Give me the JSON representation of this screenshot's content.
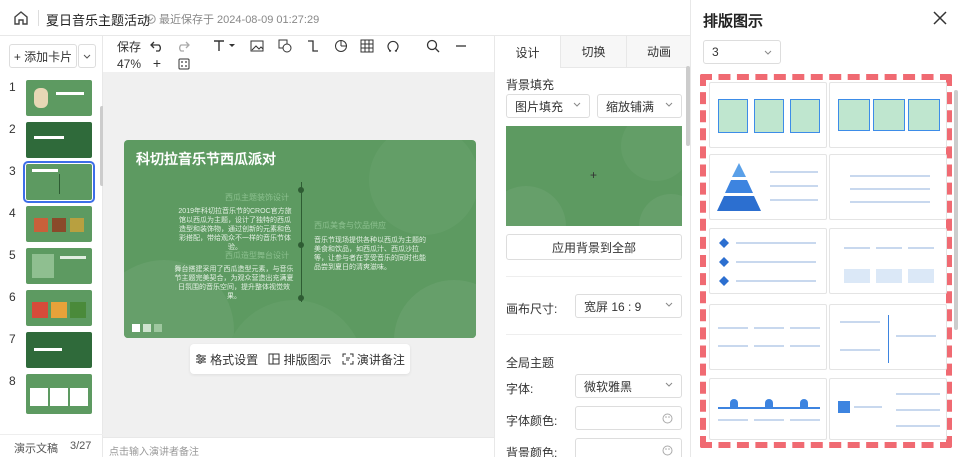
{
  "header": {
    "title": "夏日音乐主题活动",
    "save_status": "最近保存于 2024-08-09 01:27:29"
  },
  "sidebar": {
    "add_card_label": "+ 添加卡片",
    "slides": [
      "1",
      "2",
      "3",
      "4",
      "5",
      "6",
      "7",
      "8"
    ],
    "selected_index": 3,
    "footer_label": "演示文稿",
    "page_indicator": "3/27"
  },
  "toolbar": {
    "save_label": "保存",
    "zoom": "47%",
    "zoom_in": "+"
  },
  "slide": {
    "title": "科切拉音乐节西瓜派对",
    "heading_left_1": "西瓜主题装饰设计",
    "text_left_1": "2019年科切拉音乐节的CROC官方旅馆以西瓜为主题，设计了独特的西瓜造型和装饰物，通过创新的元素和色彩搭配，带给观众不一样的音乐节体验。",
    "heading_right": "西瓜美食与饮品供应",
    "text_right": "音乐节现场提供各种以西瓜为主题的美食和饮品，如西瓜汁、西瓜沙拉等，让参与者在享受音乐的同时也能品尝到夏日的清爽滋味。",
    "heading_left_2": "西瓜造型舞台设计",
    "text_left_2": "舞台搭建采用了西瓜造型元素，与音乐节主题完美契合，为观众营造出充满夏日氛围的音乐空间，提升整体视觉效果。"
  },
  "action_bar": {
    "format_label": "格式设置",
    "layout_label": "排版图示",
    "notes_label": "演讲备注"
  },
  "notes_placeholder": "点击输入演讲者备注",
  "properties": {
    "tabs": [
      "设计",
      "切换",
      "动画"
    ],
    "bg_fill_label": "背景填充",
    "fill_type": "图片填充",
    "fill_mode": "缩放铺满",
    "preview_plus": "+",
    "apply_all_label": "应用背景到全部",
    "canvas_size_label": "画布尺寸:",
    "canvas_size_value": "宽屏 16 : 9",
    "theme_label": "全局主题",
    "font_label": "字体:",
    "font_value": "微软雅黑",
    "font_color_label": "字体颜色:",
    "bg_color_label": "背景颜色:"
  },
  "layout_panel": {
    "title": "排版图示",
    "count_value": "3"
  },
  "colors": {
    "slide_green": "#5d9a61",
    "accent_blue": "#3d6ee8",
    "dash_red": "#f06a72"
  }
}
